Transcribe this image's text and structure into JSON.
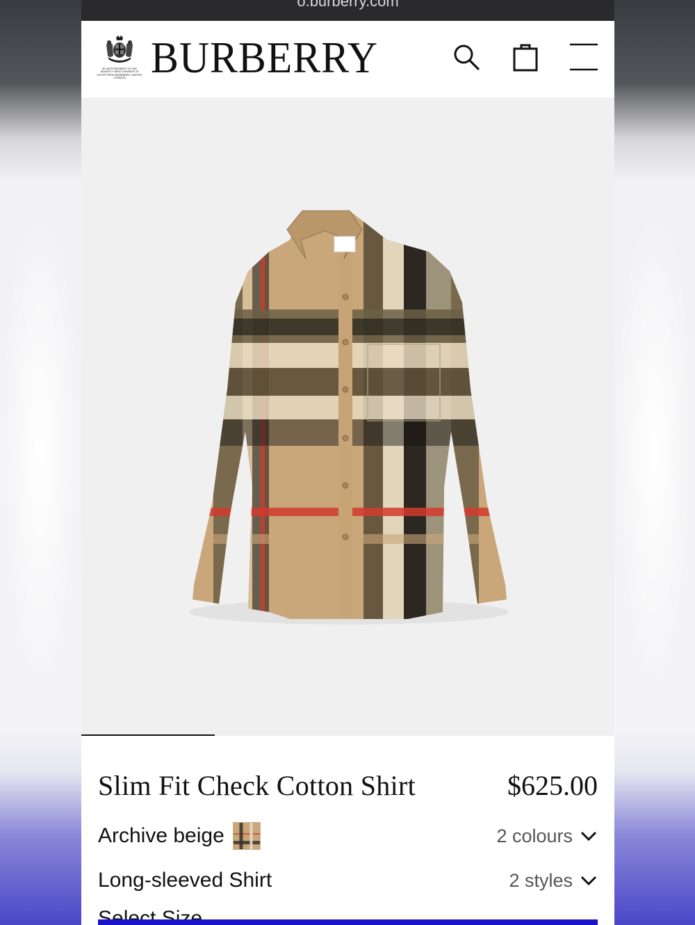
{
  "browser": {
    "url": "o.burberry.com"
  },
  "header": {
    "brand": "BURBERRY",
    "warrant_text": "By appointment to His Majesty King Charles III Outfitters Burberry Limited London",
    "icons": [
      "search-icon",
      "shopping-bag-icon",
      "menu-icon"
    ]
  },
  "gallery": {
    "image_description_icon": "product-photo",
    "progress": 0.25
  },
  "product": {
    "title": "Slim Fit Check Cotton Shirt",
    "price": "$625.00",
    "colour_name": "Archive beige",
    "colour_count": "2 colours",
    "style_name": "Long-sleeved Shirt",
    "style_count": "2 styles",
    "size_label": "Select Size"
  },
  "colors": {
    "accent_bar": "#1a14c8",
    "check_beige": "#c9a77a",
    "check_red": "#d23a2e"
  }
}
